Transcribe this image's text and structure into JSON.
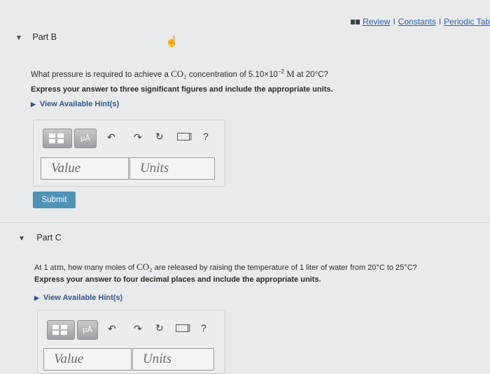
{
  "top_links": {
    "review": "Review",
    "constants": "Constants",
    "periodic": "Periodic Tab",
    "sep": "I"
  },
  "part_b": {
    "title": "Part B",
    "question_pre": "What pressure is required to achieve a ",
    "question_formula": "CO₂",
    "question_mid": " concentration of 5.10×10",
    "question_exp": "−2",
    "question_unit": " M",
    "question_post": " at 20°C?",
    "instruction": "Express your answer to three significant figures and include the appropriate units.",
    "hint_label": "View Available Hint(s)",
    "value_placeholder": "Value",
    "units_placeholder": "Units",
    "submit_label": "Submit"
  },
  "part_c": {
    "title": "Part C",
    "question_pre": "At 1 ",
    "question_atm": "atm",
    "question_mid": ", how many moles of ",
    "question_formula": "CO₂",
    "question_post": " are released by raising the temperature of 1 liter of water from 20°C to 25°C?",
    "instruction": "Express your answer to four decimal places and include the appropriate units.",
    "hint_label": "View Available Hint(s)",
    "value_placeholder": "Value",
    "units_placeholder": "Units"
  },
  "toolbar": {
    "units_btn": "μÅ",
    "help": "?",
    "keyboard_suffix": "]"
  },
  "colors": {
    "accent": "#2e5fa6",
    "submit": "#4f93b5",
    "page_bg": "#e9eaeb"
  }
}
